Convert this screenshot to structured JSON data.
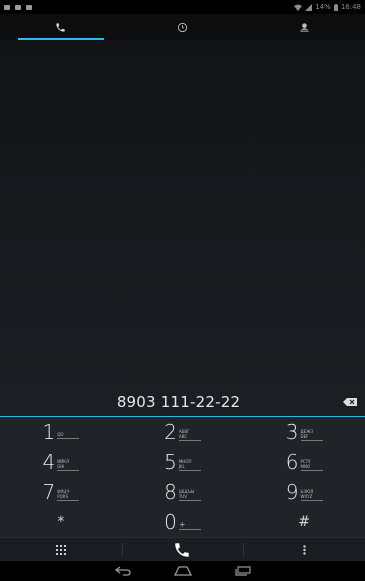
{
  "status_bar": {
    "battery": "14%",
    "time": "16:48"
  },
  "tabs": [
    {
      "name": "phone-icon",
      "active": true
    },
    {
      "name": "recent-calls-icon",
      "active": false
    },
    {
      "name": "contacts-icon",
      "active": false
    }
  ],
  "dialer": {
    "number": "8903 111-22-22"
  },
  "keypad": [
    {
      "digit": "1",
      "letters": [
        "QO",
        ""
      ]
    },
    {
      "digit": "2",
      "letters": [
        "АБВГ",
        "ABC"
      ]
    },
    {
      "digit": "3",
      "letters": [
        "ДЕЖЗ",
        "DEF"
      ]
    },
    {
      "digit": "4",
      "letters": [
        "ИЙКЛ",
        "GHI"
      ]
    },
    {
      "digit": "5",
      "letters": [
        "МНОП",
        "JKL"
      ]
    },
    {
      "digit": "6",
      "letters": [
        "РСТУ",
        "MNO"
      ]
    },
    {
      "digit": "7",
      "letters": [
        "ФХЦЧ",
        "PQRS"
      ]
    },
    {
      "digit": "8",
      "letters": [
        "ШЩЪЫ",
        "TUV"
      ]
    },
    {
      "digit": "9",
      "letters": [
        "ЬЭЮЯ",
        "WXYZ"
      ]
    },
    {
      "symbol": "*"
    },
    {
      "digit": "0",
      "plus": "+"
    },
    {
      "symbol": "#"
    }
  ],
  "colors": {
    "accent": "#33b5e5",
    "keypad_bg": "#202428"
  }
}
